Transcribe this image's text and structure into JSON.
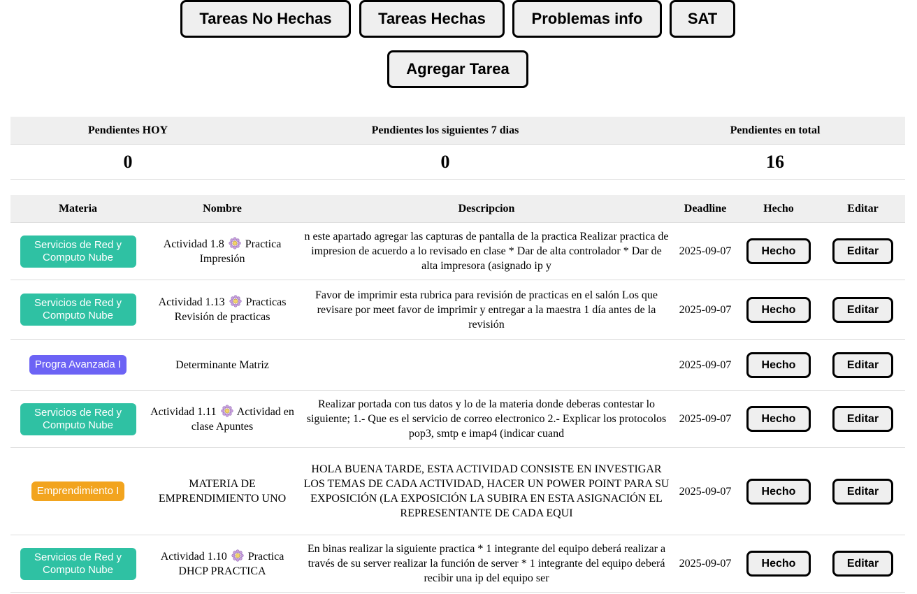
{
  "nav": {
    "buttons": [
      "Tareas No Hechas",
      "Tareas Hechas",
      "Problemas info",
      "SAT"
    ],
    "add_task": "Agregar Tarea"
  },
  "summary": {
    "headers": [
      "Pendientes HOY",
      "Pendientes los siguientes 7 dias",
      "Pendientes en total"
    ],
    "values": [
      "0",
      "0",
      "16"
    ]
  },
  "table": {
    "headers": [
      "Materia",
      "Nombre",
      "Descripcion",
      "Deadline",
      "Hecho",
      "Editar"
    ],
    "hecho_label": "Hecho",
    "editar_label": "Editar",
    "badge_colors": {
      "Servicios de Red y Computo Nube": "#2fc1a3",
      "Progra Avanzada I": "#6c63f5",
      "Emprendimiento I": "#f2a41e"
    },
    "rows": [
      {
        "materia": "Servicios de Red y Computo Nube",
        "nombre_pre": "Actividad 1.8",
        "icon": "gear-flower-icon",
        "nombre_post": "Practica Impresión",
        "descripcion": "n este apartado agregar las capturas de pantalla de la practica Realizar practica de impresion de acuerdo a lo revisado en clase * Dar de alta controlador * Dar de alta impresora (asignado ip y",
        "deadline": "2025-09-07"
      },
      {
        "materia": "Servicios de Red y Computo Nube",
        "nombre_pre": "Actividad 1.13",
        "icon": "gear-flower-icon",
        "nombre_post": "Practicas Revisión de practicas",
        "descripcion": "Favor de imprimir esta rubrica para revisión de practicas en el salón Los que revisare por meet favor de imprimir y entregar a la maestra 1 día antes de la revisión",
        "deadline": "2025-09-07"
      },
      {
        "materia": "Progra Avanzada I",
        "nombre_pre": "Determinante Matriz",
        "icon": "",
        "nombre_post": "",
        "descripcion": "",
        "deadline": "2025-09-07"
      },
      {
        "materia": "Servicios de Red y Computo Nube",
        "nombre_pre": "Actividad 1.11",
        "icon": "gear-flower-icon",
        "nombre_post": "Actividad en clase Apuntes",
        "descripcion": "Realizar portada con tus datos y lo de la materia donde deberas contestar lo siguiente; 1.- Que es el servicio de correo electronico 2.- Explicar los protocolos pop3, smtp e imap4 (indicar cuand",
        "deadline": "2025-09-07"
      },
      {
        "materia": "Emprendimiento I",
        "nombre_pre": "MATERIA DE EMPRENDIMIENTO UNO",
        "icon": "",
        "nombre_post": "",
        "descripcion": "HOLA BUENA TARDE, ESTA ACTIVIDAD CONSISTE EN INVESTIGAR LOS TEMAS DE CADA ACTIVIDAD, HACER UN POWER POINT PARA SU EXPOSICIÓN (LA EXPOSICIÓN LA SUBIRA EN ESTA ASIGNACIÓN EL REPRESENTANTE DE CADA EQUI",
        "deadline": "2025-09-07"
      },
      {
        "materia": "Servicios de Red y Computo Nube",
        "nombre_pre": "Actividad 1.10",
        "icon": "gear-flower-icon",
        "nombre_post": "Practica DHCP PRACTICA",
        "descripcion": "En binas realizar la siguiente practica * 1 integrante del equipo deberá realizar a través de su server realizar la función de server * 1 integrante del equipo deberá recibir una ip del equipo ser",
        "deadline": "2025-09-07"
      }
    ]
  }
}
